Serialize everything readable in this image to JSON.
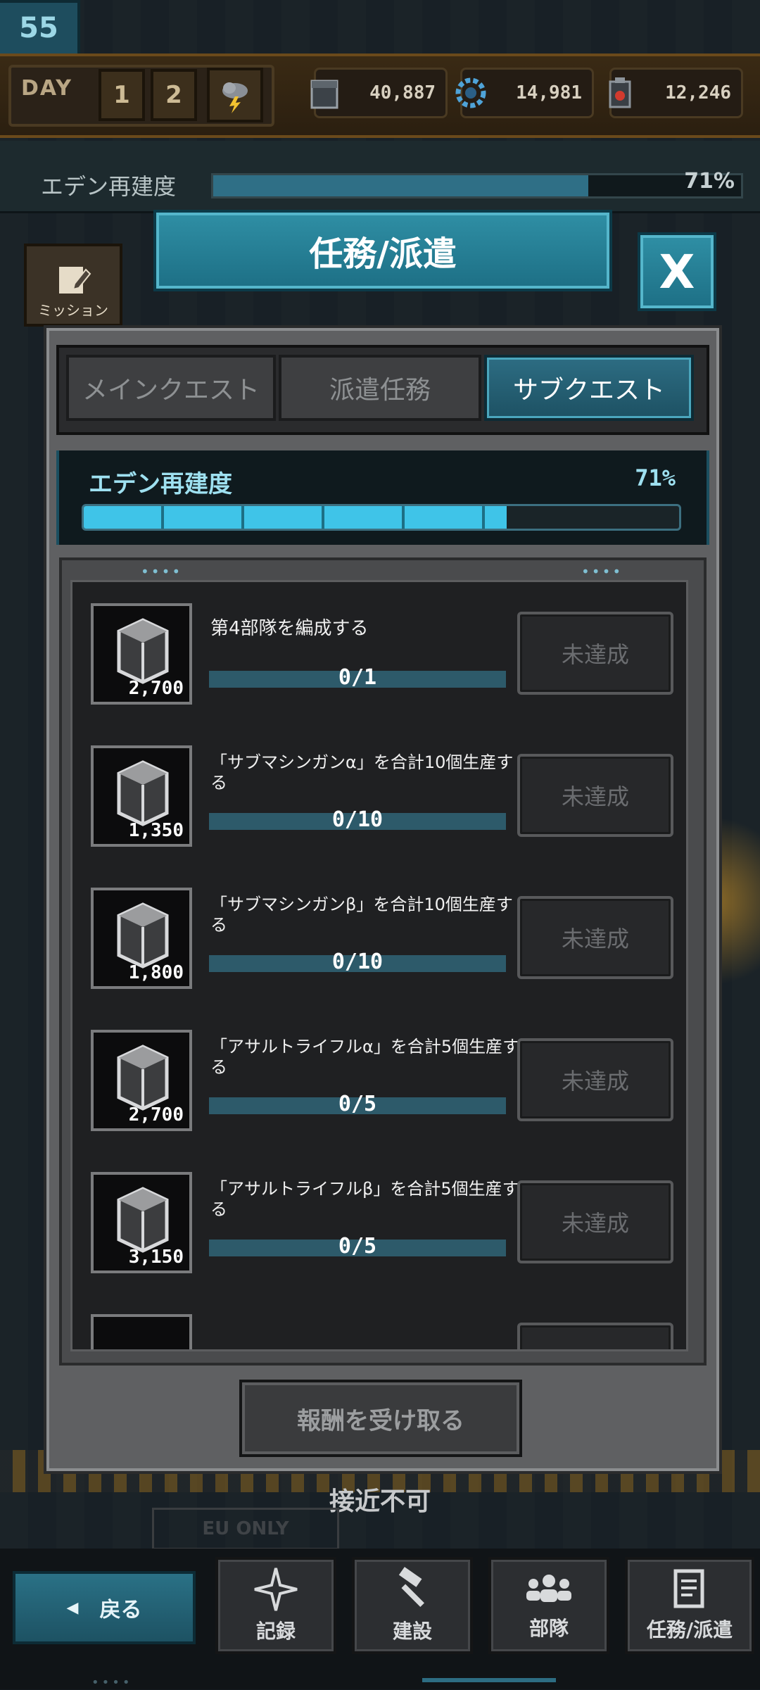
{
  "level": "55",
  "topbar": {
    "day_label": "DAY",
    "day_digits": [
      "1",
      "2"
    ],
    "weather_icon": "storm-icon",
    "resources": [
      {
        "icon": "metal-block-icon",
        "value": "40,887"
      },
      {
        "icon": "gear-icon",
        "value": "14,981"
      },
      {
        "icon": "fuel-can-icon",
        "value": "12,246"
      }
    ]
  },
  "eden_strip": {
    "label": "エデン再建度",
    "percent_text": "71%",
    "progress": 0.71
  },
  "mission_side": {
    "label": "ミッション"
  },
  "dialog": {
    "title": "任務/派遣",
    "close_label": "X",
    "tabs": [
      {
        "label": "メインクエスト",
        "active": false
      },
      {
        "label": "派遣任務",
        "active": false
      },
      {
        "label": "サブクエスト",
        "active": true
      }
    ],
    "eden": {
      "label": "エデン再建度",
      "percent_text": "71%",
      "progress": 0.71
    },
    "tasks": [
      {
        "reward": "2,700",
        "text": "第4部隊を編成する",
        "progress_text": "0/1",
        "status": "未達成"
      },
      {
        "reward": "1,350",
        "text": "「サブマシンガンα」を合計10個生産する",
        "progress_text": "0/10",
        "status": "未達成"
      },
      {
        "reward": "1,800",
        "text": "「サブマシンガンβ」を合計10個生産する",
        "progress_text": "0/10",
        "status": "未達成"
      },
      {
        "reward": "2,700",
        "text": "「アサルトライフルα」を合計5個生産する",
        "progress_text": "0/5",
        "status": "未達成"
      },
      {
        "reward": "3,150",
        "text": "「アサルトライフルβ」を合計5個生産する",
        "progress_text": "0/5",
        "status": "未達成"
      }
    ],
    "claim_label": "報酬を受け取る"
  },
  "restricted_text": "接近不可",
  "eu_sign": "EU ONLY",
  "nav": {
    "back": "戻る",
    "items": [
      {
        "label": "記録",
        "icon": "compass-star-icon"
      },
      {
        "label": "建設",
        "icon": "hammer-icon"
      },
      {
        "label": "部隊",
        "icon": "squad-icon"
      },
      {
        "label": "任務/派遣",
        "icon": "document-icon"
      }
    ]
  },
  "colors": {
    "accent": "#2f8fa5",
    "progress": "#3fc4e8",
    "panel": "#5f6062"
  }
}
